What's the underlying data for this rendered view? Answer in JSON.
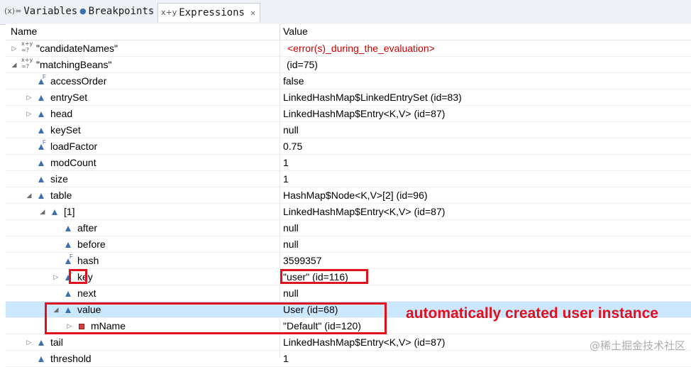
{
  "tabs": [
    {
      "label": "Variables",
      "icon": "variables-icon",
      "glyph": "(x)="
    },
    {
      "label": "Breakpoints",
      "icon": "breakpoints-icon",
      "glyph": "●"
    },
    {
      "label": "Expressions",
      "icon": "expressions-icon",
      "glyph": "x+y"
    }
  ],
  "tab_close_glyph": "✕",
  "columns": {
    "name": "Name",
    "value": "Value"
  },
  "rows": [
    {
      "name": "\"candidateNames\"",
      "value": "<error(s)_during_the_evaluation>"
    },
    {
      "name": "\"matchingBeans\"",
      "value": "(id=75)"
    },
    {
      "name": "accessOrder",
      "value": "false"
    },
    {
      "name": "entrySet",
      "value": "LinkedHashMap$LinkedEntrySet  (id=83)"
    },
    {
      "name": "head",
      "value": "LinkedHashMap$Entry<K,V>  (id=87)"
    },
    {
      "name": "keySet",
      "value": "null"
    },
    {
      "name": "loadFactor",
      "value": "0.75"
    },
    {
      "name": "modCount",
      "value": "1"
    },
    {
      "name": "size",
      "value": "1"
    },
    {
      "name": "table",
      "value": "HashMap$Node<K,V>[2]  (id=96)"
    },
    {
      "name": "[1]",
      "value": "LinkedHashMap$Entry<K,V>  (id=87)"
    },
    {
      "name": "after",
      "value": "null"
    },
    {
      "name": "before",
      "value": "null"
    },
    {
      "name": "hash",
      "value": "3599357"
    },
    {
      "name": "key",
      "value": "\"user\" (id=116)"
    },
    {
      "name": "next",
      "value": "null"
    },
    {
      "name": "value",
      "value": "User  (id=68)"
    },
    {
      "name": "mName",
      "value": "\"Default\" (id=120)"
    },
    {
      "name": "tail",
      "value": "LinkedHashMap$Entry<K,V>  (id=87)"
    },
    {
      "name": "threshold",
      "value": "1"
    }
  ],
  "annotation": "automatically created user instance",
  "watermark": "@稀土掘金技术社区",
  "colors": {
    "highlight": "#e0111d",
    "selection": "#cce8ff",
    "error_text": "#cc0000"
  }
}
